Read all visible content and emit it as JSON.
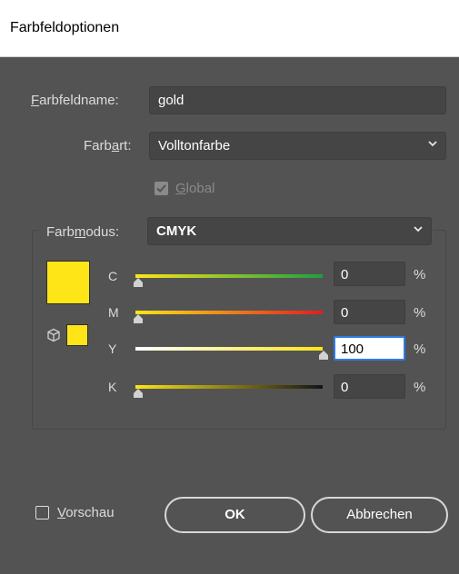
{
  "window": {
    "title": "Farbfeldoptionen"
  },
  "swatch_name": {
    "label_prefix": "F",
    "label_rest": "arbfeldname:",
    "value": "gold"
  },
  "color_type": {
    "label_prefix": "Farb",
    "label_u": "a",
    "label_rest": "rt:",
    "value": "Volltonfarbe"
  },
  "global": {
    "label_u": "G",
    "label_rest": "lobal",
    "checked": true,
    "disabled": true
  },
  "color_mode": {
    "label_prefix": "Farb",
    "label_u": "m",
    "label_rest": "odus:",
    "value": "CMYK"
  },
  "preview_color": "#fde517",
  "channels": [
    {
      "label": "C",
      "value": "0",
      "percent": 0,
      "unit": "%"
    },
    {
      "label": "M",
      "value": "0",
      "percent": 0,
      "unit": "%"
    },
    {
      "label": "Y",
      "value": "100",
      "percent": 100,
      "unit": "%"
    },
    {
      "label": "K",
      "value": "0",
      "percent": 0,
      "unit": "%"
    }
  ],
  "preview": {
    "label_u": "V",
    "label_rest": "orschau",
    "checked": false
  },
  "buttons": {
    "ok": "OK",
    "cancel": "Abbrechen"
  },
  "colors": {
    "accent": "#2f7be6",
    "panel": "#535353",
    "field": "#454545"
  }
}
